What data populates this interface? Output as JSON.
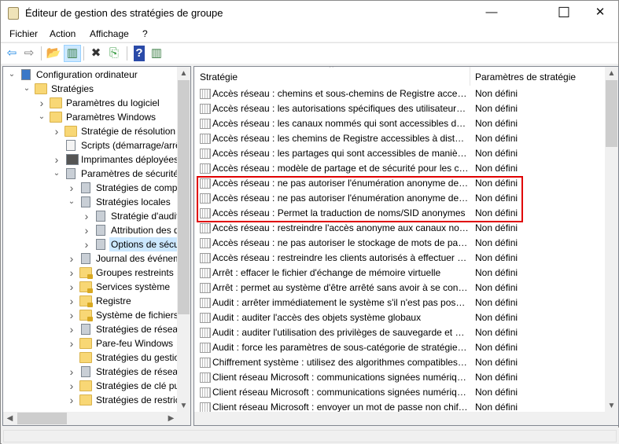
{
  "window": {
    "title": "Éditeur de gestion des stratégies de groupe",
    "minimize": "—",
    "maximize": "☐",
    "close": "✕"
  },
  "menu": [
    "Fichier",
    "Action",
    "Affichage",
    "?"
  ],
  "toolbar": [
    {
      "name": "back-icon",
      "glyph": "⇦",
      "color": "#1e88e5"
    },
    {
      "name": "forward-icon",
      "glyph": "⇨",
      "color": "#777"
    },
    {
      "name": "up-folder-icon",
      "glyph": "📂",
      "color": "#c9a030"
    },
    {
      "name": "show-hide-tree-icon",
      "glyph": "▥",
      "color": "#3a7d44"
    },
    {
      "name": "delete-icon",
      "glyph": "✖",
      "color": "#333"
    },
    {
      "name": "export-list-icon",
      "glyph": "⎘",
      "color": "#3a9d44"
    },
    {
      "name": "help-icon",
      "glyph": "?",
      "color": "#fff"
    },
    {
      "name": "show-action-pane-icon",
      "glyph": "▥",
      "color": "#3a7d44"
    }
  ],
  "tree": [
    {
      "label": "Configuration ordinateur",
      "level": 0,
      "state": "expanded",
      "icon": "computer"
    },
    {
      "label": "Stratégies",
      "level": 1,
      "state": "expanded",
      "icon": "folder"
    },
    {
      "label": "Paramètres du logiciel",
      "level": 2,
      "state": "collapsed",
      "icon": "folder"
    },
    {
      "label": "Paramètres Windows",
      "level": 2,
      "state": "expanded",
      "icon": "folder"
    },
    {
      "label": "Stratégie de résolution",
      "level": 3,
      "state": "collapsed",
      "icon": "folder"
    },
    {
      "label": "Scripts (démarrage/arrêt)",
      "level": 3,
      "state": "none",
      "icon": "script"
    },
    {
      "label": "Imprimantes déployées",
      "level": 3,
      "state": "collapsed",
      "icon": "printer"
    },
    {
      "label": "Paramètres de sécurité",
      "level": 3,
      "state": "expanded",
      "icon": "security"
    },
    {
      "label": "Stratégies de comptes",
      "level": 4,
      "state": "collapsed",
      "icon": "server"
    },
    {
      "label": "Stratégies locales",
      "level": 4,
      "state": "expanded",
      "icon": "server"
    },
    {
      "label": "Stratégie d'audit",
      "level": 5,
      "state": "collapsed",
      "icon": "server"
    },
    {
      "label": "Attribution des droits",
      "level": 5,
      "state": "collapsed",
      "icon": "server"
    },
    {
      "label": "Options de sécurité",
      "level": 5,
      "state": "collapsed",
      "icon": "server",
      "selected": true
    },
    {
      "label": "Journal des événements",
      "level": 4,
      "state": "collapsed",
      "icon": "server"
    },
    {
      "label": "Groupes restreints",
      "level": 4,
      "state": "collapsed",
      "icon": "lockfolder"
    },
    {
      "label": "Services système",
      "level": 4,
      "state": "collapsed",
      "icon": "lockfolder"
    },
    {
      "label": "Registre",
      "level": 4,
      "state": "collapsed",
      "icon": "lockfolder"
    },
    {
      "label": "Système de fichiers",
      "level": 4,
      "state": "collapsed",
      "icon": "lockfolder"
    },
    {
      "label": "Stratégies de réseau",
      "level": 4,
      "state": "collapsed",
      "icon": "server"
    },
    {
      "label": "Pare-feu Windows",
      "level": 4,
      "state": "collapsed",
      "icon": "folder"
    },
    {
      "label": "Stratégies du gestionnaire",
      "level": 4,
      "state": "none",
      "icon": "folder"
    },
    {
      "label": "Stratégies de réseau sans fil",
      "level": 4,
      "state": "collapsed",
      "icon": "server"
    },
    {
      "label": "Stratégies de clé publique",
      "level": 4,
      "state": "collapsed",
      "icon": "folder"
    },
    {
      "label": "Stratégies de restriction",
      "level": 4,
      "state": "collapsed",
      "icon": "folder"
    }
  ],
  "list": {
    "columns": [
      "Stratégie",
      "Paramètres de stratégie"
    ],
    "rows": [
      {
        "name": "Accès réseau : chemins et sous-chemins de Registre accessibles à distance",
        "value": "Non défini"
      },
      {
        "name": "Accès réseau : les autorisations spécifiques des utilisateurs anonymes",
        "value": "Non défini"
      },
      {
        "name": "Accès réseau : les canaux nommés qui sont accessibles de manière anonyme",
        "value": "Non défini"
      },
      {
        "name": "Accès réseau : les chemins de Registre accessibles à distance",
        "value": "Non défini"
      },
      {
        "name": "Accès réseau : les partages qui sont accessibles de manière anonyme",
        "value": "Non défini"
      },
      {
        "name": "Accès réseau : modèle de partage et de sécurité pour les comptes locaux",
        "value": "Non défini"
      },
      {
        "name": "Accès réseau : ne pas autoriser l'énumération anonyme des comptes SAM",
        "value": "Non défini",
        "highlighted": true
      },
      {
        "name": "Accès réseau : ne pas autoriser l'énumération anonyme des comptes et partages SAM",
        "value": "Non défini",
        "highlighted": true
      },
      {
        "name": "Accès réseau : Permet la traduction de noms/SID anonymes",
        "value": "Non défini",
        "highlighted": true
      },
      {
        "name": "Accès réseau : restreindre l'accès anonyme aux canaux nommés et partages",
        "value": "Non défini"
      },
      {
        "name": "Accès réseau : ne pas autoriser le stockage de mots de passe et d'informations",
        "value": "Non défini"
      },
      {
        "name": "Accès réseau : restreindre les clients autorisés à effectuer des appels à distance",
        "value": "Non défini"
      },
      {
        "name": "Arrêt : effacer le fichier d'échange de mémoire virtuelle",
        "value": "Non défini"
      },
      {
        "name": "Arrêt : permet au système d'être arrêté sans avoir à se connecter",
        "value": "Non défini"
      },
      {
        "name": "Audit : arrêter immédiatement le système s'il n'est pas possible",
        "value": "Non défini"
      },
      {
        "name": "Audit : auditer l'accès des objets système globaux",
        "value": "Non défini"
      },
      {
        "name": "Audit : auditer l'utilisation des privilèges de sauvegarde et de restauration",
        "value": "Non défini"
      },
      {
        "name": "Audit : force les paramètres de sous-catégorie de stratégie d'audit",
        "value": "Non défini"
      },
      {
        "name": "Chiffrement système : utilisez des algorithmes compatibles FIPS",
        "value": "Non défini"
      },
      {
        "name": "Client réseau Microsoft : communications signées numériquement (toujours)",
        "value": "Non défini"
      },
      {
        "name": "Client réseau Microsoft : communications signées numériquement (lorsque)",
        "value": "Non défini"
      },
      {
        "name": "Client réseau Microsoft : envoyer un mot de passe non chiffré",
        "value": "Non défini"
      }
    ]
  },
  "colors": {
    "highlight_box": "#e00000",
    "selection": "#cce8ff"
  }
}
